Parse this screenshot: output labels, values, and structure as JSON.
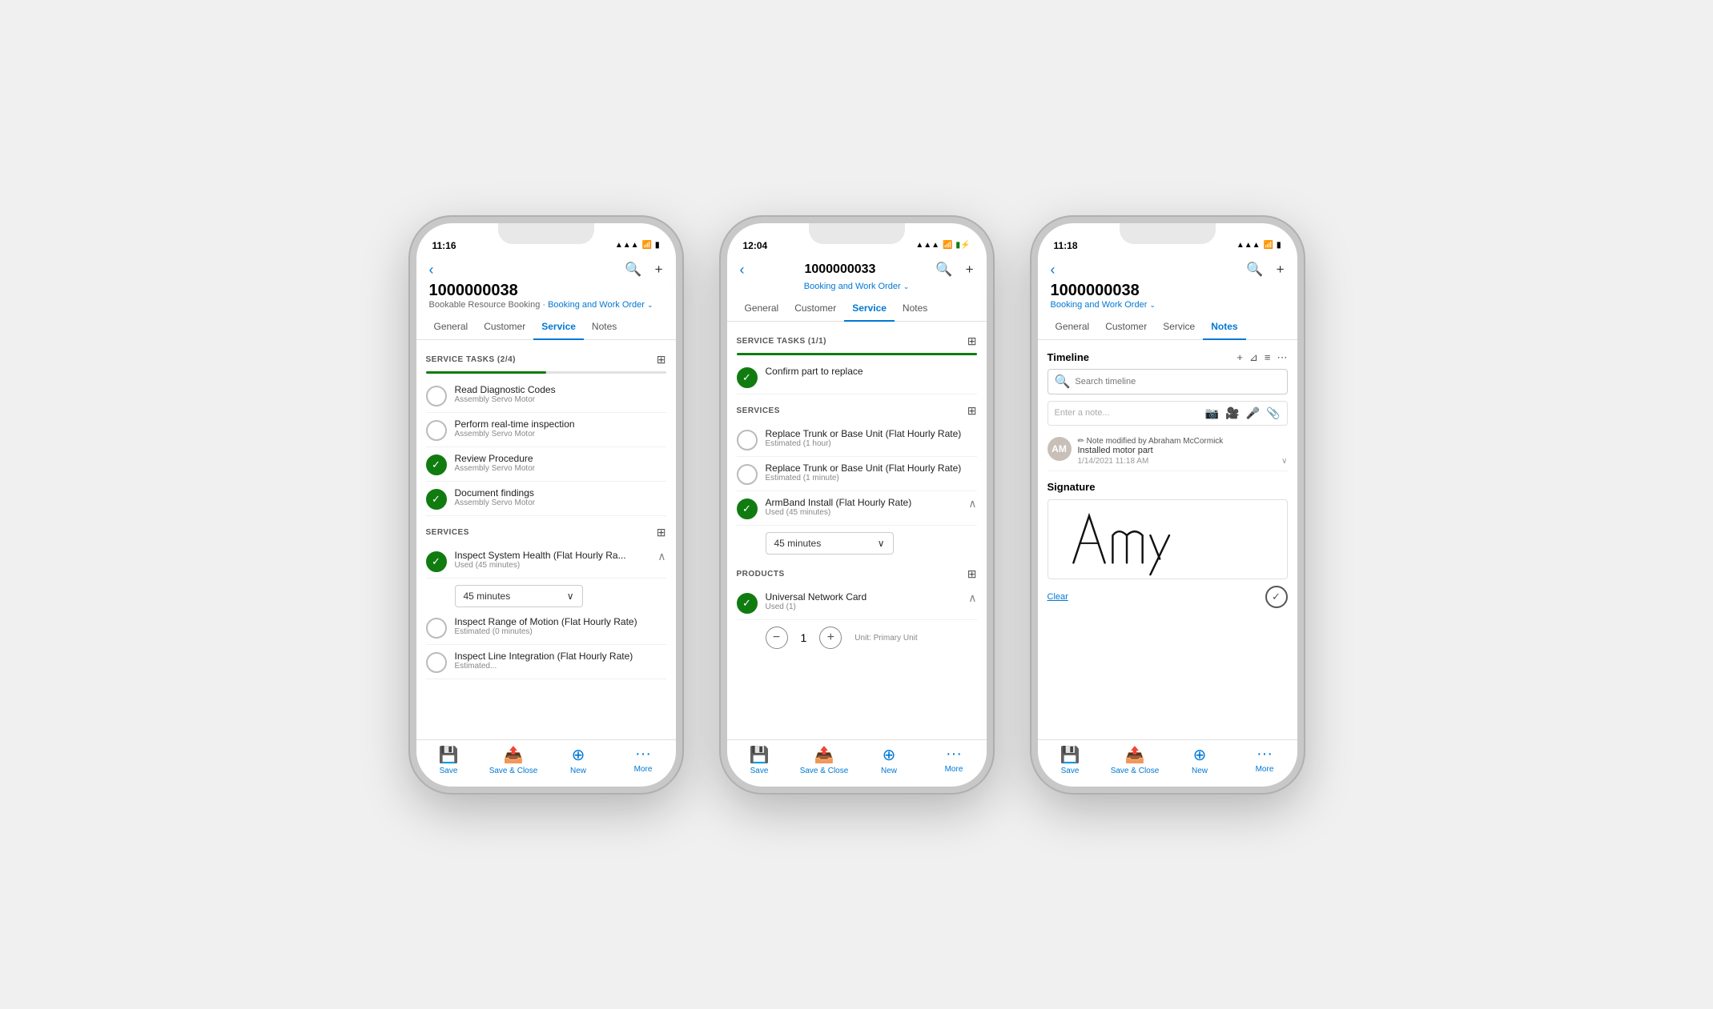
{
  "phones": [
    {
      "id": "phone1",
      "statusBar": {
        "time": "11:16",
        "timeIcon": "◂",
        "signal": "▲▲▲",
        "wifi": "WiFi",
        "battery": "🔋"
      },
      "header": {
        "title": "1000000038",
        "subtitle": "Bookable Resource Booking  ·",
        "subtitleLink": "Booking and Work Order",
        "chevron": "⌄"
      },
      "tabs": [
        {
          "label": "General",
          "active": false
        },
        {
          "label": "Customer",
          "active": false
        },
        {
          "label": "Service",
          "active": true
        },
        {
          "label": "Notes",
          "active": false
        }
      ],
      "sections": [
        {
          "type": "tasks",
          "title": "SERVICE TASKS (2/4)",
          "progress": 50,
          "items": [
            {
              "name": "Read Diagnostic Codes",
              "sub": "Assembly Servo Motor",
              "done": false
            },
            {
              "name": "Perform real-time inspection",
              "sub": "Assembly Servo Motor",
              "done": false
            },
            {
              "name": "Review Procedure",
              "sub": "Assembly Servo Motor",
              "done": true
            },
            {
              "name": "Document findings",
              "sub": "Assembly Servo Motor",
              "done": true
            }
          ]
        },
        {
          "type": "services",
          "title": "SERVICES",
          "items": [
            {
              "name": "Inspect System Health (Flat Hourly Ra...",
              "sub": "Used (45 minutes)",
              "done": true,
              "expanded": true,
              "timeValue": "45 minutes"
            },
            {
              "name": "Inspect Range of Motion (Flat Hourly Rate)",
              "sub": "Estimated (0 minutes)",
              "done": false
            },
            {
              "name": "Inspect Line Integration (Flat Hourly Rate)",
              "sub": "Estimated...",
              "done": false
            }
          ]
        }
      ],
      "bottomBar": [
        {
          "icon": "💾",
          "label": "Save"
        },
        {
          "icon": "📋",
          "label": "Save & Close"
        },
        {
          "icon": "+",
          "label": "New"
        },
        {
          "icon": "•••",
          "label": "More"
        }
      ]
    },
    {
      "id": "phone2",
      "statusBar": {
        "time": "12:04",
        "timeIcon": "◂",
        "signal": "▲▲▲",
        "wifi": "WiFi",
        "battery": "🔋"
      },
      "header": {
        "title": "1000000033",
        "subtitle": "",
        "subtitleLink": "Booking and Work Order",
        "chevron": "⌄"
      },
      "tabs": [
        {
          "label": "General",
          "active": false
        },
        {
          "label": "Customer",
          "active": false
        },
        {
          "label": "Service",
          "active": true
        },
        {
          "label": "Notes",
          "active": false
        }
      ],
      "sections": [
        {
          "type": "tasks",
          "title": "SERVICE TASKS (1/1)",
          "progress": 100,
          "items": [
            {
              "name": "Confirm part to replace",
              "sub": "",
              "done": true
            }
          ]
        },
        {
          "type": "services2",
          "title": "SERVICES",
          "items": [
            {
              "name": "Replace Trunk or Base Unit (Flat Hourly Rate)",
              "sub": "Estimated (1 hour)",
              "done": false
            },
            {
              "name": "Replace Trunk or Base Unit (Flat Hourly Rate)",
              "sub": "Estimated (1 minute)",
              "done": false
            },
            {
              "name": "ArmBand Install (Flat Hourly Rate)",
              "sub": "Used (45 minutes)",
              "done": true,
              "expanded": true,
              "timeValue": "45 minutes"
            }
          ]
        },
        {
          "type": "products",
          "title": "PRODUCTS",
          "items": [
            {
              "name": "Universal Network Card",
              "sub": "Used (1)",
              "done": true,
              "qty": "1",
              "unit": "Unit: Primary Unit"
            }
          ]
        }
      ],
      "bottomBar": [
        {
          "icon": "💾",
          "label": "Save"
        },
        {
          "icon": "📋",
          "label": "Save & Close"
        },
        {
          "icon": "+",
          "label": "New"
        },
        {
          "icon": "•••",
          "label": "More"
        }
      ]
    },
    {
      "id": "phone3",
      "statusBar": {
        "time": "11:18",
        "timeIcon": "◂",
        "signal": "▲▲▲",
        "wifi": "WiFi",
        "battery": "🔋"
      },
      "header": {
        "title": "1000000038",
        "subtitle": "",
        "subtitleLink": "Booking and Work Order",
        "chevron": "⌄"
      },
      "tabs": [
        {
          "label": "General",
          "active": false
        },
        {
          "label": "Customer",
          "active": false
        },
        {
          "label": "Service",
          "active": false
        },
        {
          "label": "Notes",
          "active": true
        }
      ],
      "notes": {
        "timelineTitle": "Timeline",
        "searchPlaceholder": "Search timeline",
        "noteInputPlaceholder": "Enter a note...",
        "noteAuthor": "Note modified by Abraham McCormick",
        "noteText": "Installed motor part",
        "noteTime": "1/14/2021 11:18 AM",
        "signatureTitle": "Signature",
        "clearLabel": "Clear"
      },
      "bottomBar": [
        {
          "icon": "💾",
          "label": "Save"
        },
        {
          "icon": "📋",
          "label": "Save & Close"
        },
        {
          "icon": "+",
          "label": "New"
        },
        {
          "icon": "•••",
          "label": "More"
        }
      ]
    }
  ],
  "icons": {
    "back": "‹",
    "search": "🔍",
    "add": "+",
    "save": "💾",
    "saveClose": "📤",
    "new": "+",
    "more": "···",
    "check": "✓",
    "expand": "∧",
    "chevronDown": "∨",
    "filter": "⊿",
    "list": "≡",
    "dots": "⋯",
    "camera": "📷",
    "video": "🎥",
    "mic": "🎤",
    "attach": "📎",
    "edit": "✏"
  }
}
